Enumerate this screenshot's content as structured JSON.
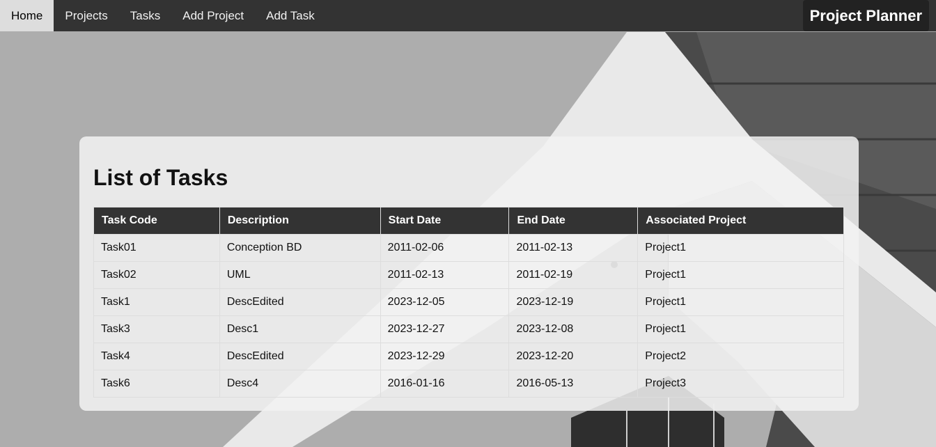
{
  "nav": {
    "items": [
      {
        "label": "Home",
        "active": true
      },
      {
        "label": "Projects",
        "active": false
      },
      {
        "label": "Tasks",
        "active": false
      },
      {
        "label": "Add Project",
        "active": false
      },
      {
        "label": "Add Task",
        "active": false
      }
    ],
    "brand": "Project Planner"
  },
  "content": {
    "title": "List of Tasks",
    "table": {
      "headers": [
        "Task Code",
        "Description",
        "Start Date",
        "End Date",
        "Associated Project"
      ],
      "rows": [
        [
          "Task01",
          "Conception BD",
          "2011-02-06",
          "2011-02-13",
          "Project1"
        ],
        [
          "Task02",
          "UML",
          "2011-02-13",
          "2011-02-19",
          "Project1"
        ],
        [
          "Task1",
          "DescEdited",
          "2023-12-05",
          "2023-12-19",
          "Project1"
        ],
        [
          "Task3",
          "Desc1",
          "2023-12-27",
          "2023-12-08",
          "Project1"
        ],
        [
          "Task4",
          "DescEdited",
          "2023-12-29",
          "2023-12-20",
          "Project2"
        ],
        [
          "Task6",
          "Desc4",
          "2016-01-16",
          "2016-05-13",
          "Project3"
        ]
      ]
    }
  },
  "colors": {
    "nav_bg": "#333333",
    "nav_active_bg": "#dddddd",
    "brand_bg": "#222222",
    "table_header_bg": "#333333"
  }
}
